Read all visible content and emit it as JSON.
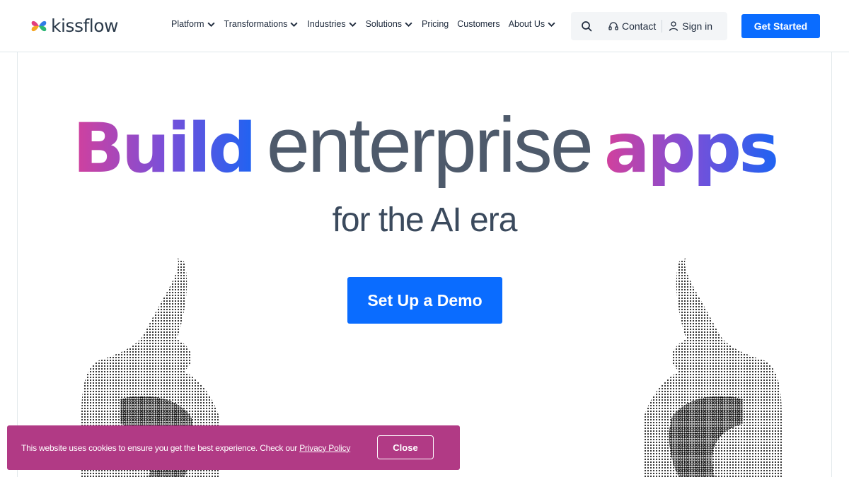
{
  "brand": {
    "name": "kissflow",
    "logo_colors": [
      "#e23d7e",
      "#2f7be6",
      "#2bb673",
      "#f5a623"
    ],
    "accent": "#0a6cff"
  },
  "nav": {
    "items": [
      {
        "label": "Platform",
        "has_dropdown": true
      },
      {
        "label": "Transformations",
        "has_dropdown": true
      },
      {
        "label": "Industries",
        "has_dropdown": true
      },
      {
        "label": "Solutions",
        "has_dropdown": true
      },
      {
        "label": "Pricing",
        "has_dropdown": false
      },
      {
        "label": "Customers",
        "has_dropdown": false
      },
      {
        "label": "About Us",
        "has_dropdown": true
      }
    ]
  },
  "utility": {
    "search_icon": "search-icon",
    "contact_label": "Contact",
    "contact_icon": "headset-icon",
    "signin_label": "Sign in",
    "signin_icon": "user-icon"
  },
  "header_cta": {
    "label": "Get Started"
  },
  "hero": {
    "word1": "Build",
    "word2": "enterprise",
    "word3": "apps",
    "line2": "for the AI era",
    "cta_label": "Set Up a Demo",
    "gradient": [
      "#d3409c",
      "#7b4fd8",
      "#1f63f2"
    ]
  },
  "cookie_banner": {
    "text": "This website uses cookies to ensure you get the best experience. Check our ",
    "link_label": "Privacy Policy",
    "close_label": "Close",
    "background": "#b13a85"
  }
}
